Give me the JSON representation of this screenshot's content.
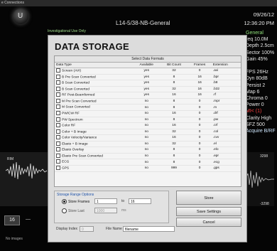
{
  "window": {
    "title": "e Connections"
  },
  "header": {
    "probe_label": "L14-5/38-NB-General",
    "investigational": "Investigational Use Only",
    "date": "09/26/12",
    "time": "12:36:20 PM"
  },
  "params": {
    "preset": "General",
    "lines": [
      "req 10.0M",
      "Depth 2.5cm",
      "Sector 100%",
      "Gain 45%",
      "",
      "FPS 26Hz",
      "Dyn 80dB",
      "Persist 2",
      "Map 6",
      "Chroma 0",
      "Power 0"
    ],
    "mi": "MI< (1)",
    "lines2": [
      "Clarity High",
      "SFZ 500",
      "Acquire B/RF"
    ]
  },
  "left": {
    "depth_value": "16",
    "no_images": "No images",
    "wave_label": "RIM"
  },
  "right_wave": {
    "top": "3298",
    "bottom": "-3298"
  },
  "dialog": {
    "title": "DATA STORAGE",
    "select_header": "Select Data Formats",
    "columns": [
      "Data Type",
      "Available",
      "Bit Count",
      "Frames",
      "Extension"
    ],
    "rows": [
      [
        "Screen (AVI)",
        "yes",
        "32",
        "0",
        ".avi"
      ],
      [
        "B Pre Scan Converted",
        "yes",
        "8",
        "16",
        ".bpr"
      ],
      [
        "B Scan Converted",
        "yes",
        "8",
        "16",
        ".b8"
      ],
      [
        "B Scan Converted",
        "yes",
        "32",
        "16",
        ".b32"
      ],
      [
        "RF Post-Beamformed",
        "yes",
        "16",
        "16",
        ".rf"
      ],
      [
        "M Pre Scan Converted",
        "no",
        "8",
        "0",
        ".mpr"
      ],
      [
        "M Scan Converted",
        "no",
        "8",
        "0",
        ".m"
      ],
      [
        "PW/CW RF",
        "no",
        "16",
        "0",
        ".drf"
      ],
      [
        "PW Spectrum",
        "no",
        "8",
        "0",
        ".pw"
      ],
      [
        "Color RF",
        "no",
        "16",
        "0",
        ".crf"
      ],
      [
        "Color + B Image",
        "no",
        "32",
        "0",
        ".col"
      ],
      [
        "Color Velocity/Variance",
        "no",
        "16",
        "0",
        ".cvv"
      ],
      [
        "Elasto + B Image",
        "no",
        "32",
        "0",
        ".el"
      ],
      [
        "Elasto Overlay",
        "no",
        "8",
        "0",
        ".elo"
      ],
      [
        "Elasto Pre Scan Converted",
        "no",
        "8",
        "0",
        ".epr"
      ],
      [
        "ECG",
        "no",
        "8",
        "0",
        ".ecg"
      ],
      [
        "GPS",
        "no",
        "999",
        "0",
        ".gps"
      ]
    ],
    "storage": {
      "label": "Storage Range Options",
      "store_frames_label": "Store Frames",
      "store_frames_from": "1",
      "to_label": "to",
      "store_frames_to": "16",
      "store_last_label": "Store Last",
      "store_last_value": "1000",
      "ms_label": "ms",
      "display_index_label": "Display Index",
      "display_index_value": "0",
      "file_name_label": "File Name",
      "file_name_value": "filename"
    },
    "buttons": {
      "store": "Store",
      "save_settings": "Save Settings",
      "cancel": "Cancel"
    }
  }
}
